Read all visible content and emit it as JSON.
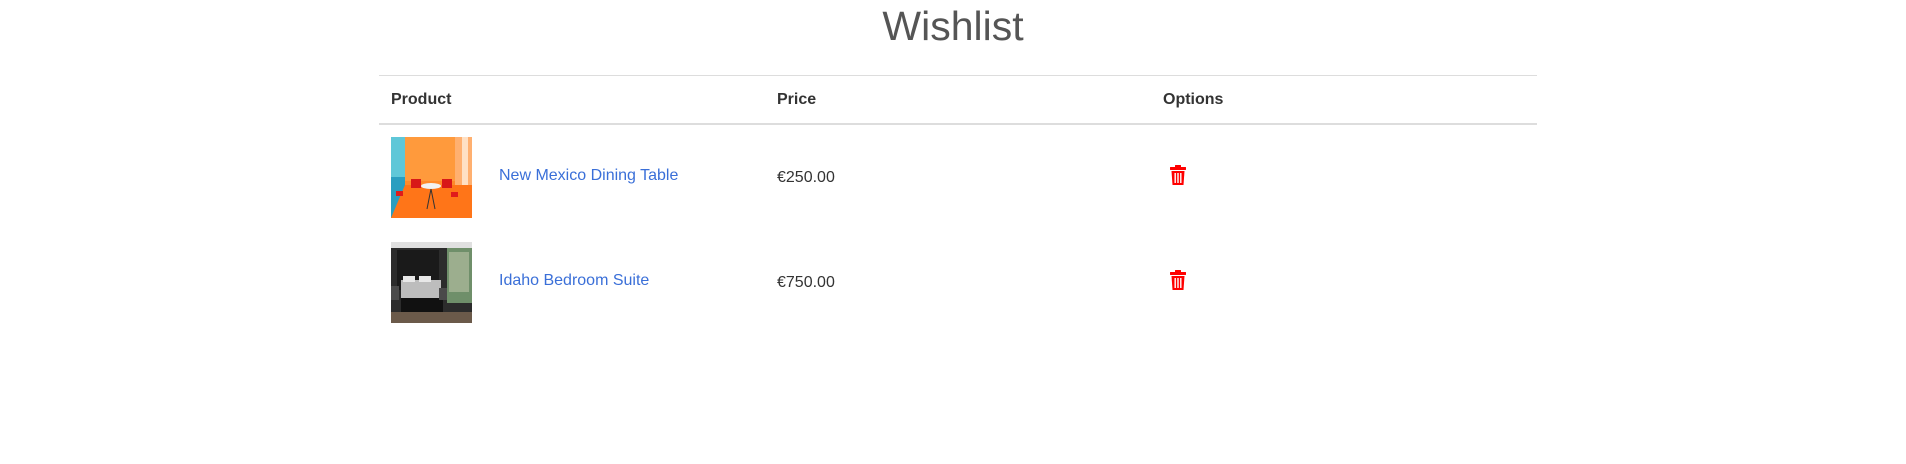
{
  "page": {
    "title": "Wishlist"
  },
  "table": {
    "headers": {
      "product": "Product",
      "price": "Price",
      "options": "Options"
    },
    "rows": [
      {
        "product_name": "New Mexico Dining Table",
        "price": "€250.00",
        "image_icon": "dining-room-orange-photo",
        "remove_icon": "trash-icon"
      },
      {
        "product_name": "Idaho Bedroom Suite",
        "price": "€750.00",
        "image_icon": "bedroom-dark-photo",
        "remove_icon": "trash-icon"
      }
    ]
  },
  "colors": {
    "title": "#555555",
    "link": "#3a6fd8",
    "trash": "#ff0000",
    "border": "#dddddd"
  }
}
